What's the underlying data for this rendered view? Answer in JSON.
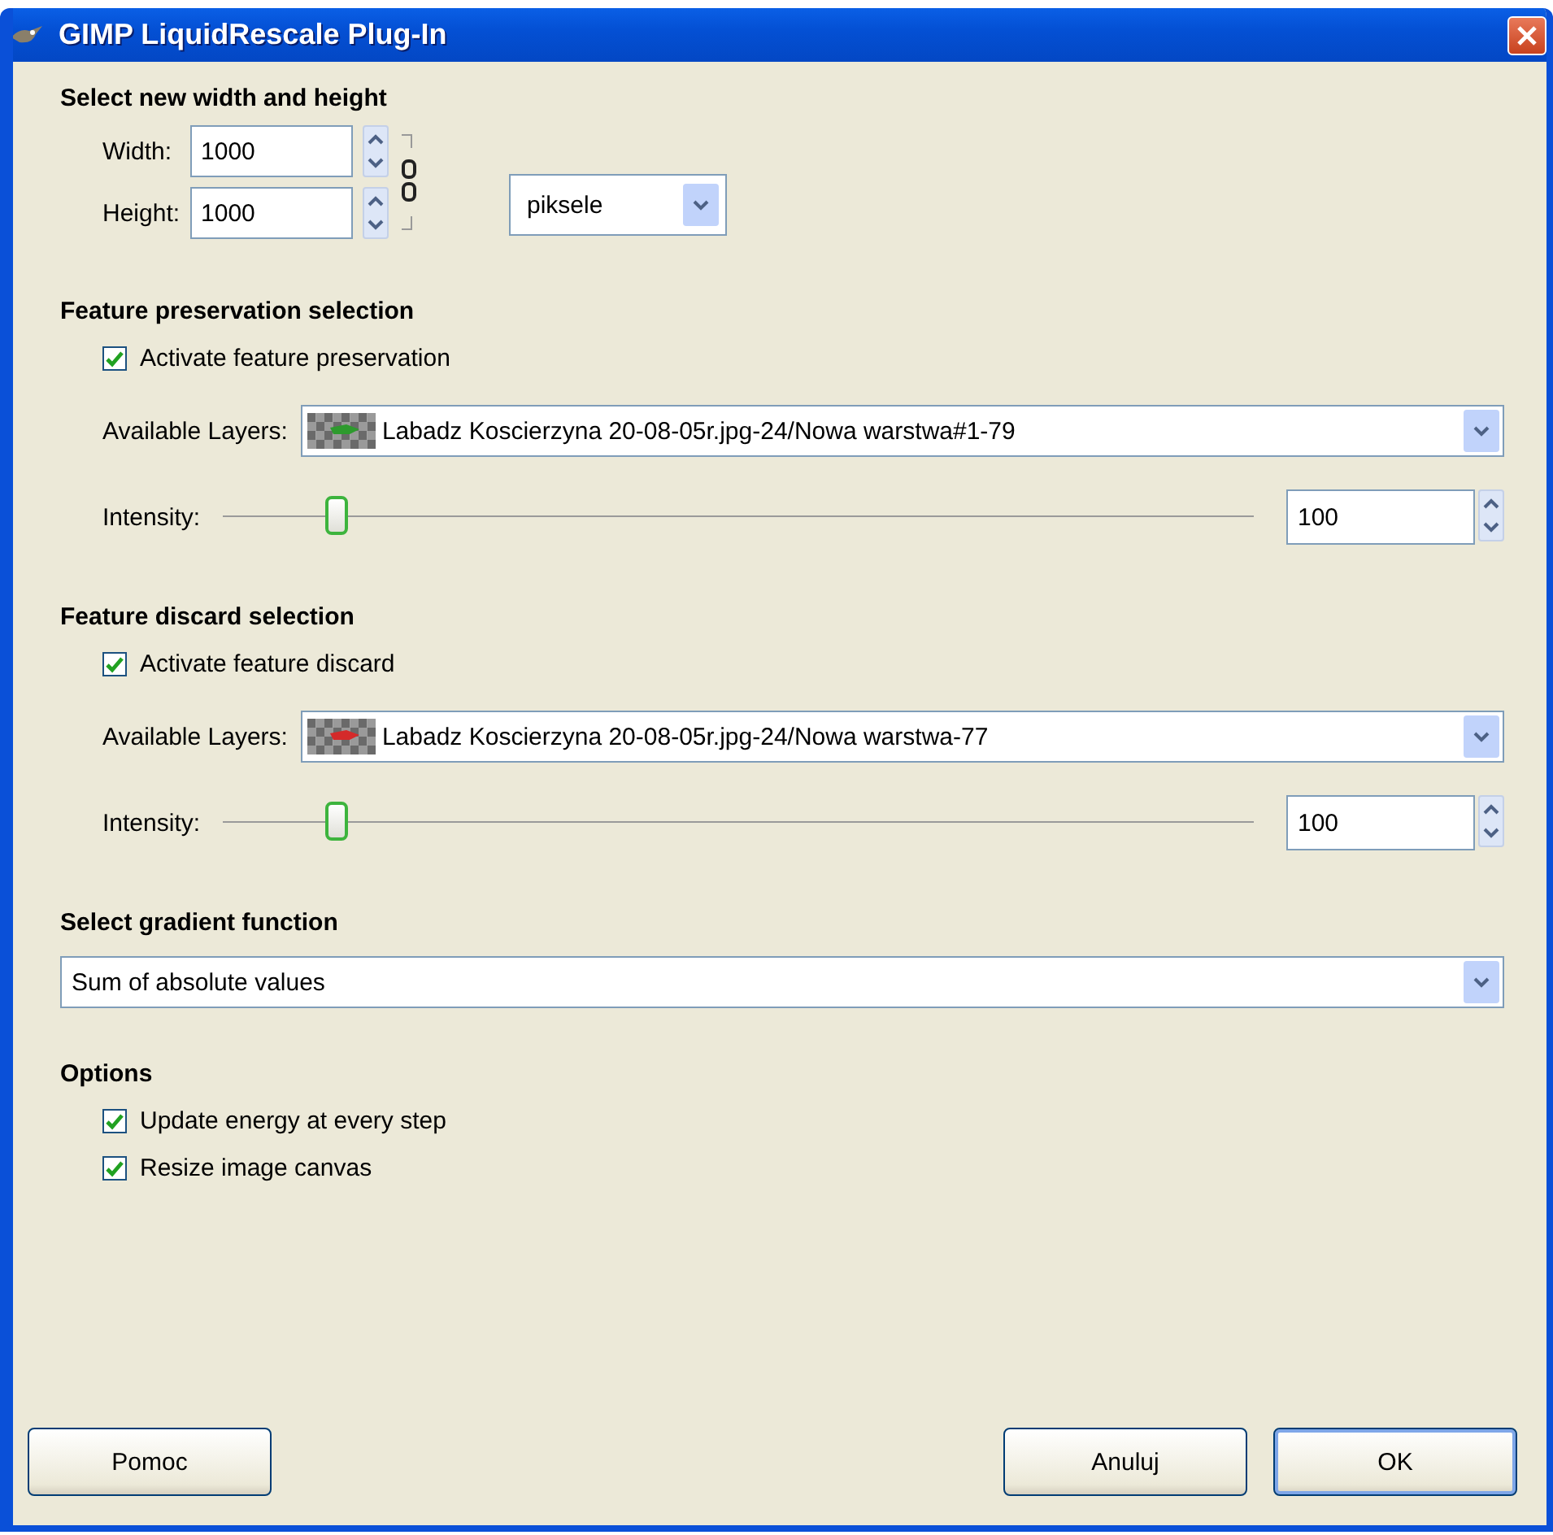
{
  "window": {
    "title": "GIMP LiquidRescale Plug-In"
  },
  "size": {
    "heading": "Select new width and height",
    "width_label": "Width:",
    "width_value": "1000",
    "height_label": "Height:",
    "height_value": "1000",
    "unit": "piksele"
  },
  "sections": [
    {
      "heading": "Feature preservation selection",
      "activate": {
        "label": "Activate feature preservation",
        "checked": true
      },
      "layers_label": "Available Layers:",
      "layer": {
        "name": "Labadz Koscierzyna 20-08-05r.jpg-24/Nowa warstwa#1-79",
        "color": "#2e9a2e"
      },
      "intensity_label": "Intensity:",
      "intensity": {
        "level": 0.11,
        "value": "100"
      }
    },
    {
      "heading": "Feature discard selection",
      "activate": {
        "label": "Activate feature discard",
        "checked": true
      },
      "layers_label": "Available Layers:",
      "layer": {
        "name": "Labadz Koscierzyna 20-08-05r.jpg-24/Nowa warstwa-77",
        "color": "#d42a2a"
      },
      "intensity_label": "Intensity:",
      "intensity": {
        "level": 0.11,
        "value": "100"
      }
    }
  ],
  "gradient": {
    "heading": "Select gradient function",
    "value": "Sum of absolute values"
  },
  "options": {
    "heading": "Options",
    "items": [
      {
        "label": "Update energy at every step",
        "checked": true
      },
      {
        "label": "Resize image canvas",
        "checked": true
      }
    ]
  },
  "buttons": [
    {
      "label": "Pomoc",
      "default": false
    },
    {
      "label": "Anuluj",
      "default": false
    },
    {
      "label": "OK",
      "default": true
    }
  ]
}
